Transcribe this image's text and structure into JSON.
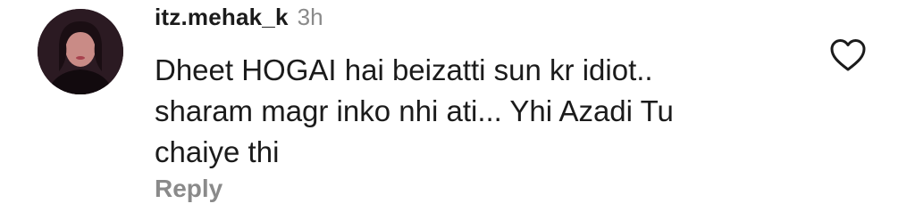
{
  "comment": {
    "username": "itz.mehak_k",
    "timestamp": "3h",
    "text": "Dheet HOGAI hai beizatti sun kr idiot..\nsharam magr inko nhi ati... Yhi Azadi Tu\nchaiye thi",
    "reply_label": "Reply",
    "avatar_icon": "user-avatar-photo",
    "like_icon": "heart-outline-icon"
  },
  "colors": {
    "text_primary": "#1b1b1b",
    "text_secondary": "#8a8a8a",
    "background": "#ffffff"
  }
}
